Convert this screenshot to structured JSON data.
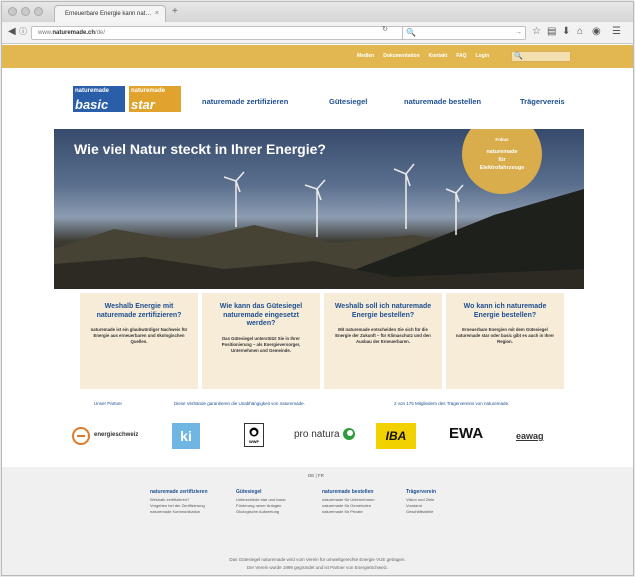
{
  "browser": {
    "tab_title": "Erneuerbare Energie kann nat…",
    "tab_close": "×",
    "new_tab": "+",
    "url_prefix": "www.",
    "url_host": "naturemade.ch",
    "url_path": "/de/",
    "back": "◀",
    "reload": "↻",
    "search_glyph": "🔍",
    "search_go": "→"
  },
  "site": {
    "top_links": [
      "Medien",
      "Dokumentation",
      "Kontakt",
      "FAQ",
      "Login"
    ],
    "search_glyph": "🔍",
    "logos": [
      {
        "small": "naturemade",
        "big": "basic"
      },
      {
        "small": "naturemade",
        "big": "star"
      }
    ],
    "nav": [
      "naturemade zertifizieren",
      "Gütesiegel",
      "naturemade bestellen",
      "Trägervereis"
    ],
    "hero_title": "Wie viel Natur steckt in Ihrer Energie?",
    "hero_badge": {
      "kicker": "Fokus",
      "line1": "naturemade",
      "line2": "für",
      "line3": "Elektrofahrzeuge"
    },
    "columns": [
      {
        "title": "Weshalb Energie mit naturemade zertifizieren?",
        "text": "naturemade ist ein glaubwürdiger Nachweis für Energie aus erneuerbaren und ökologischen Quellen."
      },
      {
        "title": "Wie kann das Gütesiegel naturemade eingesetzt werden?",
        "text": "Das Gütesiegel unterstützt Sie in Ihrer Positionierung – als Energieversorger, Unternehmen und Gemeinde."
      },
      {
        "title": "Weshalb soll ich naturemade Energie bestellen?",
        "text": "Mit naturemade entscheiden Sie sich für die Energie der Zukunft – für Klimaschutz und den Ausbau der Erneuerbaren."
      },
      {
        "title": "Wo kann ich naturemade Energie bestellen?",
        "text": "Erneuerbare Energien mit dem Gütesiegel naturemade star oder basic gibt es auch in Ihrer Region."
      }
    ],
    "partner_texts": [
      "Unser Partner",
      "Diese Verbände garantieren die Unabhängigkeit von naturemade.",
      "2 von 175 Mitgliedern des Trägervereins von naturemade."
    ],
    "partner_logos": [
      "energieschweiz",
      "ki",
      "WWF",
      "pro natura",
      "IBA",
      "EWA",
      "eawag"
    ],
    "footer": {
      "lang": "DE | FR",
      "columns": [
        {
          "head": "naturemade zertifizieren",
          "links": [
            "Weshalb zertifizieren?",
            "Vorgehen bei der Zertifizierung",
            "naturemade Kommunikation"
          ]
        },
        {
          "head": "Gütesiegel",
          "links": [
            "Unterschiede star und basic",
            "Förderung neuer Anlagen",
            "Ökologische Aufwertung"
          ]
        },
        {
          "head": "naturemade bestellen",
          "links": [
            "naturemade für Unternehmen",
            "naturemade für Gemeinden",
            "naturemade für Private"
          ]
        },
        {
          "head": "Trägerverein",
          "links": [
            "Vision und Ziele",
            "Vorstand",
            "Geschäftsstelle"
          ]
        }
      ],
      "note1": "Das Gütesiegel naturemade wird vom Verein für umweltgerechte Energie VUE getragen.",
      "note2": "Der Verein wurde 1999 gegründet und ist Partner von EnergieSchweiz."
    },
    "colors": {
      "accent": "#e3b750",
      "brand_blue": "#1e4f91"
    }
  }
}
